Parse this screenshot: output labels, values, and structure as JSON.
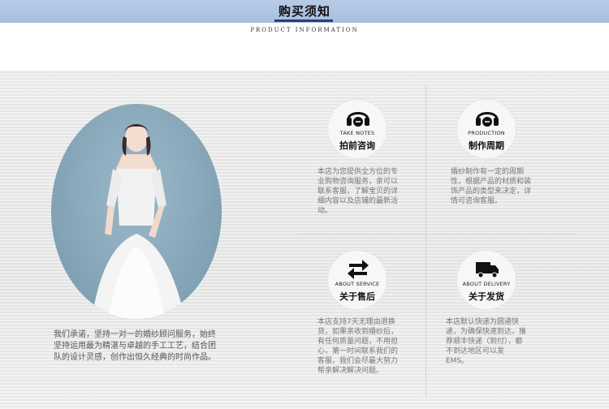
{
  "header": {
    "title": "购买须知",
    "subtitle": "PRODUCT INFORMATION"
  },
  "promise_text": "我们承诺，坚持一对一的婚纱顾问服务，始终坚持运用最为精湛与卓越的手工工艺，结合团队的设计灵感，创作出恒久经典的时尚作品。",
  "cards": [
    {
      "icon": "headset-icon",
      "en": "TAKE NOTES",
      "cn": "拍前咨询",
      "text": "本店为您提供全方位的专业购物咨询服务，亲可以联系客服，了解宝贝的详细内容以及店铺的最新活动。"
    },
    {
      "icon": "headset-icon",
      "en": "PRODUCTION",
      "cn": "制作周期",
      "text": "婚纱制作有一定的周期性，根据产品的材质和装饰产品的类型来决定，详情可咨询客服。"
    },
    {
      "icon": "exchange-arrows-icon",
      "en": "ABOUT SERVICE",
      "cn": "关于售后",
      "text": "本店支持7天无理由退换货，如果亲收到婚纱后，有任何质量问题，不用担心，第一时间联系我们的客服，我们会尽最大努力帮亲解决解决问题。"
    },
    {
      "icon": "delivery-truck-icon",
      "en": "ABOUT DELIVERY",
      "cn": "关于发货",
      "text": "本店默认快递为圆通快递，为确保快速到达，推荐顺丰快递（到付），都不到达地区可以发EMS。"
    }
  ],
  "colors": {
    "header_bg": "#a7bfe0",
    "title_underline": "#2b3f78",
    "portrait_bg": "#86a6b8"
  }
}
